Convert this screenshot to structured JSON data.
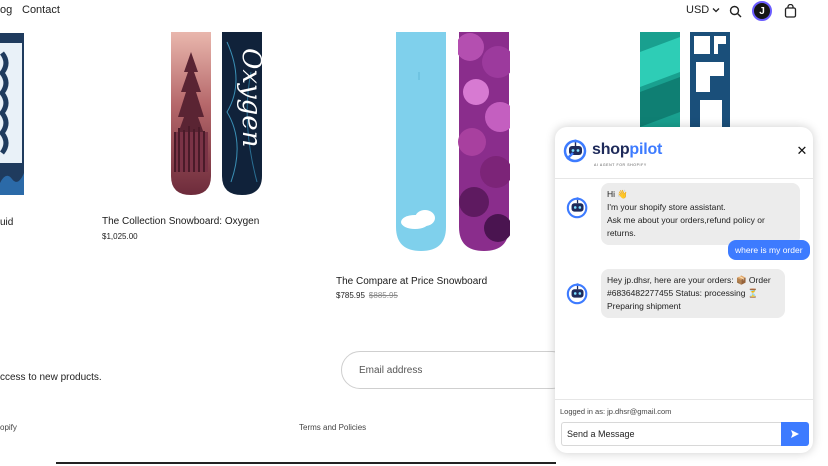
{
  "header": {
    "nav_partial": "og",
    "nav_contact": "Contact",
    "currency": "USD",
    "avatar_initial": "J"
  },
  "products": [
    {
      "title": "uid",
      "price": ""
    },
    {
      "title": "The Collection Snowboard: Oxygen",
      "price": "$1,025.00"
    },
    {
      "title": "The Compare at Price Snowboard",
      "price": "$785.95",
      "compare_price": "$885.95"
    }
  ],
  "board_text": {
    "oxygen": "Oxygen"
  },
  "newsletter": {
    "text": "ccess to new products.",
    "email_placeholder": "Email address"
  },
  "footer": {
    "left_partial": "opify",
    "terms": "Terms and Policies"
  },
  "chat": {
    "logo_shop": "shop",
    "logo_pilot": "pilot",
    "logo_tagline": "AI AGENT FOR SHOPIFY",
    "close_label": "✕",
    "messages": [
      {
        "role": "bot",
        "lines": [
          "Hi 👋",
          "I'm your shopify store assistant.",
          "Ask me about your orders,refund policy or returns."
        ]
      },
      {
        "role": "user",
        "text": "where is my order"
      },
      {
        "role": "bot",
        "lines": [
          "Hey jp.dhsr, here are your orders: 📦 Order",
          "#6836482277455 Status: processing ⏳",
          "Preparing shipment"
        ]
      }
    ],
    "logged_in": "Logged in as: jp.dhsr@gmail.com",
    "input_placeholder": "Send a Message"
  },
  "icons": {
    "currency_chevron": "chevron-down-icon",
    "search": "search-icon",
    "cart": "shopping-bag-icon",
    "send": "send-icon"
  },
  "colors": {
    "accent": "#3d7bff",
    "logo_dark": "#1e2a5a"
  }
}
